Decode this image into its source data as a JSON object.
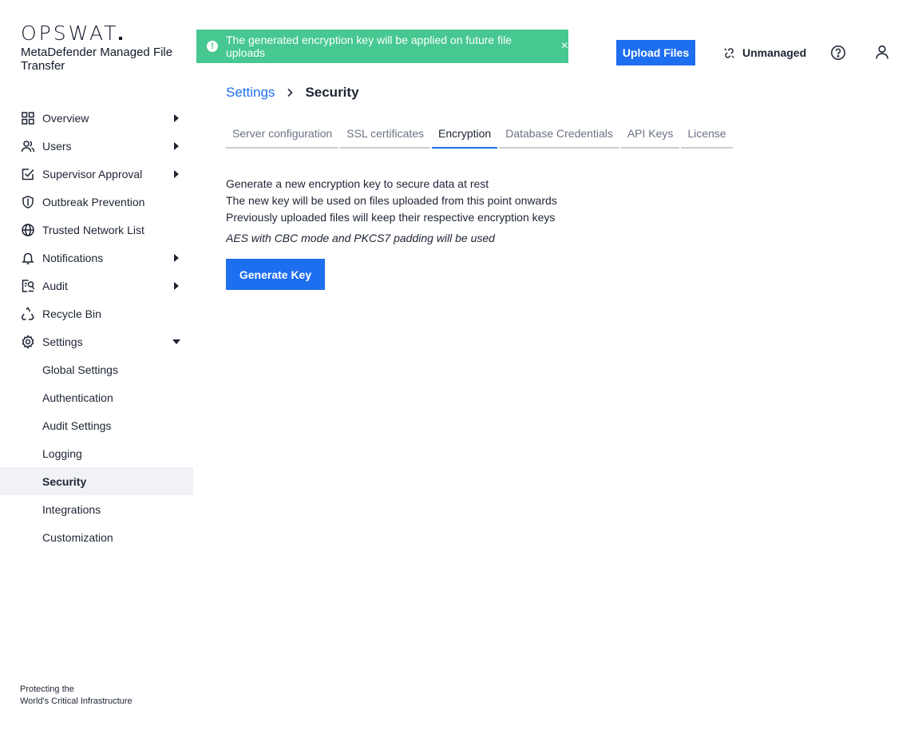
{
  "brand": {
    "logo_text": "OPSWAT",
    "product_name": "MetaDefender Managed File Transfer"
  },
  "sidebar": {
    "items": [
      {
        "label": "Overview",
        "icon": "grid-icon",
        "expandable": true
      },
      {
        "label": "Users",
        "icon": "users-icon",
        "expandable": true
      },
      {
        "label": "Supervisor Approval",
        "icon": "checkbox-approval-icon",
        "expandable": true
      },
      {
        "label": "Outbreak Prevention",
        "icon": "shield-icon",
        "expandable": false
      },
      {
        "label": "Trusted Network List",
        "icon": "globe-icon",
        "expandable": false
      },
      {
        "label": "Notifications",
        "icon": "bell-icon",
        "expandable": true
      },
      {
        "label": "Audit",
        "icon": "audit-icon",
        "expandable": true
      },
      {
        "label": "Recycle Bin",
        "icon": "recycle-icon",
        "expandable": false
      },
      {
        "label": "Settings",
        "icon": "gear-icon",
        "expandable": true,
        "expanded": true
      }
    ],
    "settings_children": [
      {
        "label": "Global Settings"
      },
      {
        "label": "Authentication"
      },
      {
        "label": "Audit Settings"
      },
      {
        "label": "Logging"
      },
      {
        "label": "Security",
        "active": true
      },
      {
        "label": "Integrations"
      },
      {
        "label": "Customization"
      }
    ],
    "footer_line1": "Protecting the",
    "footer_line2": "World's Critical Infrastructure"
  },
  "header": {
    "toast_message": "The generated encryption key will be applied on future file uploads",
    "upload_label": "Upload Files",
    "status_label": "Unmanaged"
  },
  "breadcrumb": {
    "parent": "Settings",
    "current": "Security"
  },
  "tabs": [
    {
      "label": "Server configuration"
    },
    {
      "label": "SSL certificates"
    },
    {
      "label": "Encryption",
      "active": true
    },
    {
      "label": "Database Credentials"
    },
    {
      "label": "API Keys"
    },
    {
      "label": "License"
    }
  ],
  "content": {
    "line1": "Generate a new encryption key to secure data at rest",
    "line2": "The new key will be used on files uploaded from this point onwards",
    "line3": "Previously uploaded files will keep their respective encryption keys",
    "note": "AES with CBC mode and PKCS7 padding will be used",
    "button_label": "Generate Key"
  },
  "colors": {
    "accent": "#1e6ef0",
    "toast_bg": "#46c890",
    "active_bg": "#f1f2f5"
  }
}
